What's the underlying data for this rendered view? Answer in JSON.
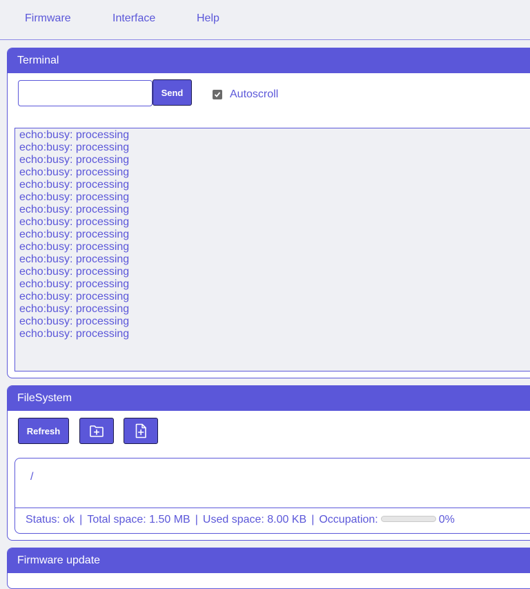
{
  "nav": {
    "items": [
      {
        "label": "Firmware"
      },
      {
        "label": "Interface"
      },
      {
        "label": "Help"
      }
    ]
  },
  "terminal": {
    "title": "Terminal",
    "input_value": "",
    "send_label": "Send",
    "autoscroll_label": "Autoscroll",
    "autoscroll_checked": true,
    "lines": [
      "echo:busy: processing",
      "echo:busy: processing",
      "echo:busy: processing",
      "echo:busy: processing",
      "echo:busy: processing",
      "echo:busy: processing",
      "echo:busy: processing",
      "echo:busy: processing",
      "echo:busy: processing",
      "echo:busy: processing",
      "echo:busy: processing",
      "echo:busy: processing",
      "echo:busy: processing",
      "echo:busy: processing",
      "echo:busy: processing",
      "echo:busy: processing",
      "echo:busy: processing"
    ]
  },
  "filesystem": {
    "title": "FileSystem",
    "refresh_label": "Refresh",
    "new_folder_icon": "folder-plus-icon",
    "upload_icon": "file-plus-icon",
    "path": "/",
    "status": {
      "status_text": "Status: ok",
      "total_text": "Total space: 1.50 MB",
      "used_text": "Used space: 8.00 KB",
      "occupation_label": "Occupation:",
      "occupation_percent_text": "0%",
      "occupation_fraction": 0
    }
  },
  "firmware_update": {
    "title": "Firmware update"
  },
  "colors": {
    "accent": "#5b57d9",
    "background": "#eff0f4"
  }
}
